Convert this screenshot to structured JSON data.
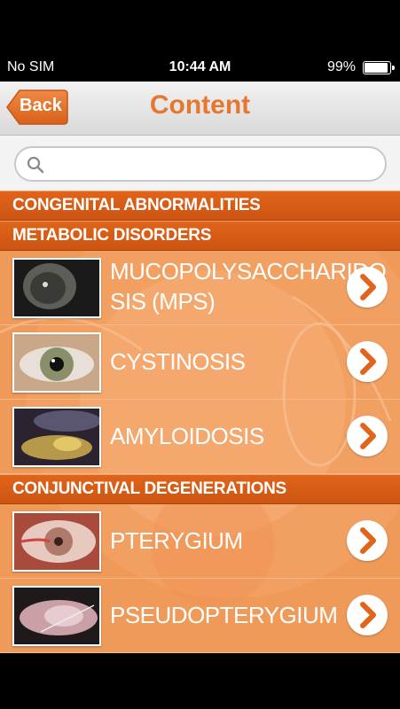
{
  "status": {
    "carrier": "No SIM",
    "time": "10:44 AM",
    "battery": "99%",
    "battery_level": 0.99
  },
  "nav": {
    "back_label": "Back",
    "title": "Content"
  },
  "search": {
    "placeholder": "",
    "value": ""
  },
  "sections": [
    {
      "title": "CONGENITAL ABNORMALITIES"
    },
    {
      "title": "METABOLIC DISORDERS"
    },
    {
      "title": "CONJUNCTIVAL DEGENERATIONS"
    }
  ],
  "rows": [
    {
      "label_line1": "MUCOPOLYSACCHARIDO",
      "label_line2": "SIS (MPS)",
      "thumb": "dark-cornea-photo"
    },
    {
      "label": "CYSTINOSIS",
      "thumb": "green-iris-photo"
    },
    {
      "label": "AMYLOIDOSIS",
      "thumb": "yellow-lesion-photo"
    },
    {
      "label": "PTERYGIUM",
      "thumb": "red-eye-photo"
    },
    {
      "label": "PSEUDOPTERYGIUM",
      "thumb": "pink-conjunctiva-photo"
    }
  ],
  "colors": {
    "accent": "#e7762e",
    "header": "#d45a15",
    "background": "#f09a5a"
  }
}
